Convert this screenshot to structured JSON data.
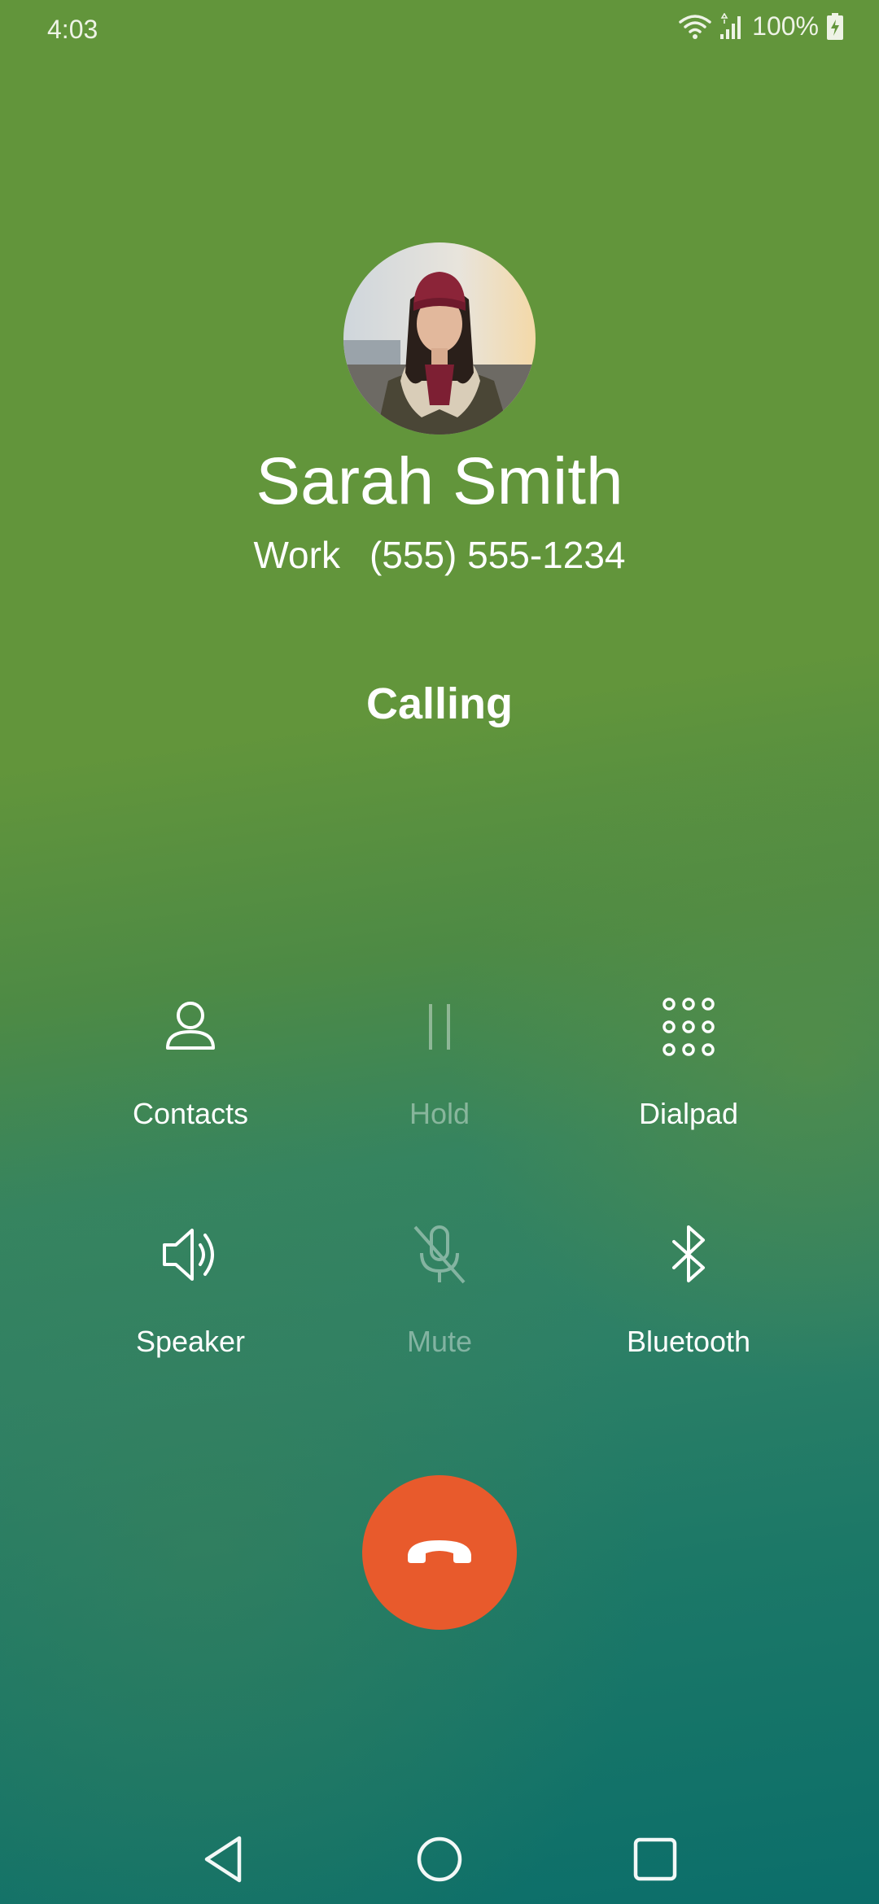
{
  "status_bar": {
    "time": "4:03",
    "battery": "100%",
    "icons": [
      "wifi-icon",
      "signal-icon",
      "battery-charging-icon"
    ]
  },
  "contact": {
    "name": "Sarah Smith",
    "label": "Work",
    "number": "(555) 555-1234",
    "avatar": "contact-photo"
  },
  "call": {
    "status": "Calling"
  },
  "actions": [
    {
      "label": "Contacts",
      "icon": "person-icon",
      "enabled": true
    },
    {
      "label": "Hold",
      "icon": "pause-icon",
      "enabled": false
    },
    {
      "label": "Dialpad",
      "icon": "dialpad-icon",
      "enabled": true
    },
    {
      "label": "Speaker",
      "icon": "speaker-icon",
      "enabled": true
    },
    {
      "label": "Mute",
      "icon": "mic-off-icon",
      "enabled": false
    },
    {
      "label": "Bluetooth",
      "icon": "bluetooth-icon",
      "enabled": true
    }
  ],
  "end_call": {
    "icon": "hang-up-icon",
    "color": "#e85a2c"
  },
  "nav_bar": {
    "icons": [
      "back-icon",
      "home-icon",
      "recents-icon"
    ]
  },
  "colors": {
    "background_top": "#62953b",
    "background_bottom": "#0b6e6a",
    "end_call": "#e85a2c",
    "text": "#ffffff"
  }
}
